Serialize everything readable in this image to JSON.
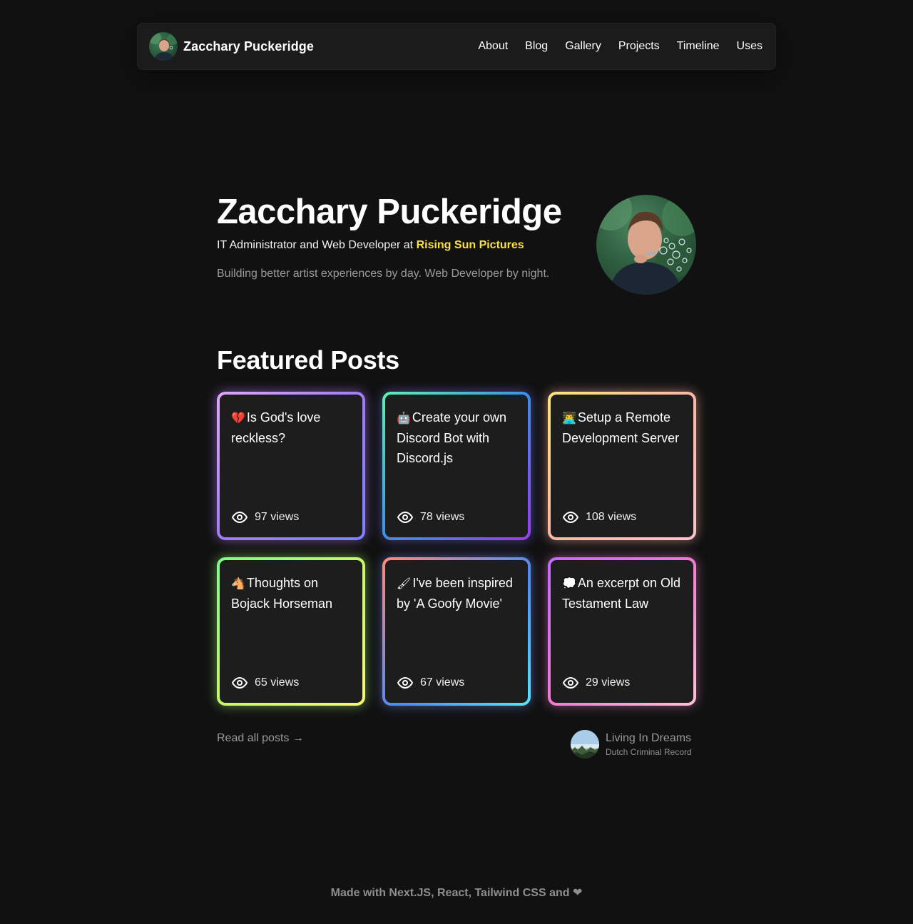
{
  "nav": {
    "brand_name": "Zacchary Puckeridge",
    "links": [
      {
        "label": "About"
      },
      {
        "label": "Blog"
      },
      {
        "label": "Gallery"
      },
      {
        "label": "Projects"
      },
      {
        "label": "Timeline"
      },
      {
        "label": "Uses"
      }
    ]
  },
  "hero": {
    "name": "Zacchary Puckeridge",
    "role_prefix": "IT Administrator and Web Developer at",
    "company": "Rising Sun Pictures",
    "tagline": "Building better artist experiences by day. Web Developer by night."
  },
  "featured": {
    "title": "Featured Posts",
    "posts": [
      {
        "emoji": "💔",
        "title": "Is God's love reckless?",
        "views": "97 views"
      },
      {
        "emoji": "🤖",
        "title": "Create your own Discord Bot with Discord.js",
        "views": "78 views"
      },
      {
        "emoji": "👨‍💻",
        "title": "Setup a Remote Development Server",
        "views": "108 views"
      },
      {
        "emoji": "🐴",
        "title": "Thoughts on Bojack Horseman",
        "views": "65 views"
      },
      {
        "emoji": "🖌",
        "title": "I've been inspired by 'A Goofy Movie'",
        "views": "67 views"
      },
      {
        "emoji": "💭",
        "title": "An excerpt on Old Testament Law",
        "views": "29 views"
      }
    ],
    "read_all": "Read all posts →"
  },
  "now_playing": {
    "title": "Living In Dreams",
    "artist": "Dutch Criminal Record"
  },
  "footer": {
    "text": "Made with Next.JS, React, Tailwind CSS and",
    "heart": "❤"
  },
  "colors": {
    "background": "#111111",
    "accent": "#f7e23c"
  }
}
